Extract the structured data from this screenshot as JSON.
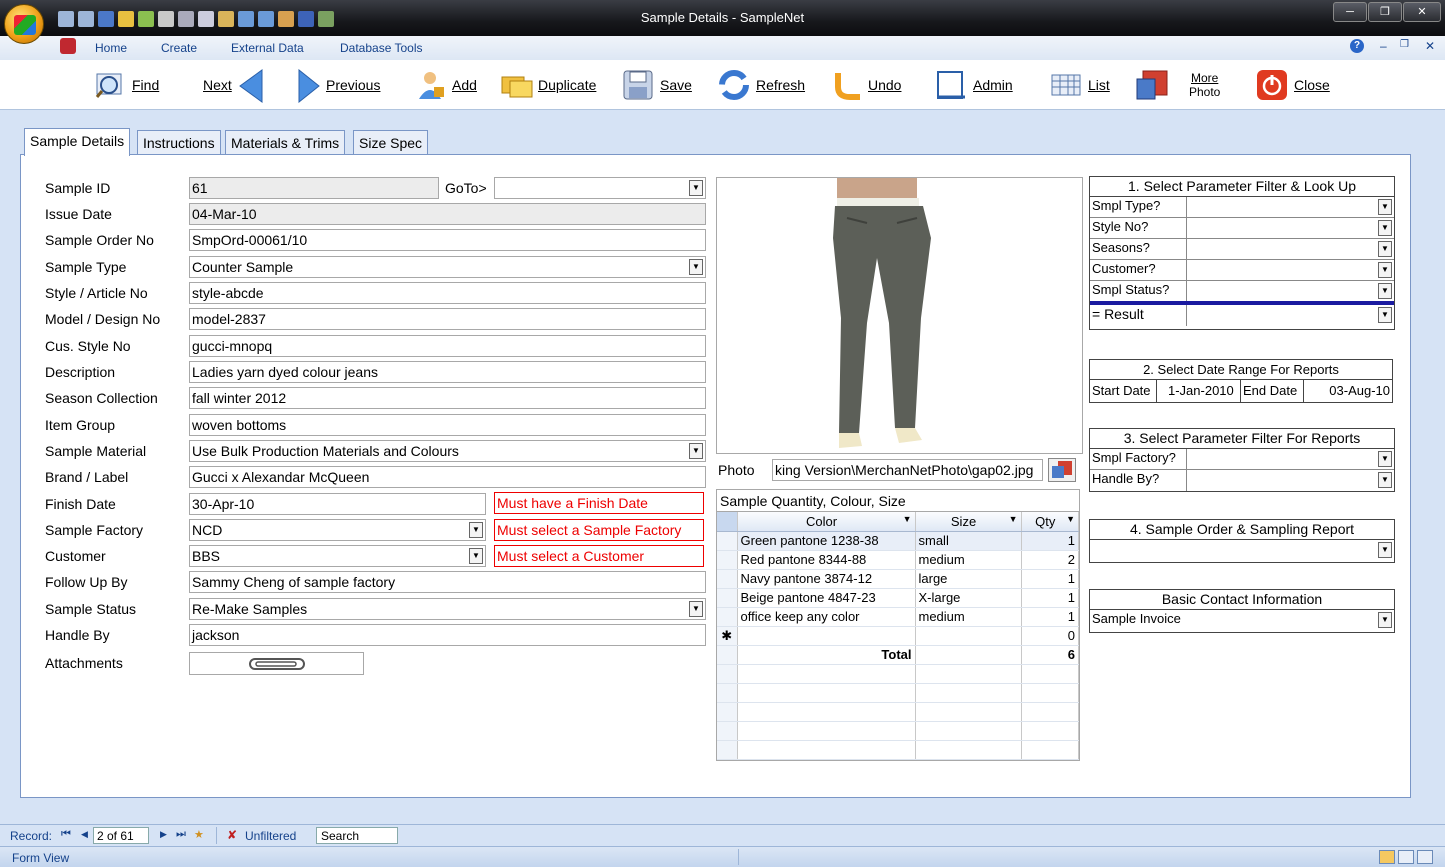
{
  "window": {
    "title": "Sample Details - SampleNet"
  },
  "ribbon": {
    "tabs": [
      "Home",
      "Create",
      "External Data",
      "Database Tools"
    ]
  },
  "toolbar": {
    "find": "Find",
    "next": "Next",
    "previous": "Previous",
    "add": "Add",
    "duplicate": "Duplicate",
    "save": "Save",
    "refresh": "Refresh",
    "undo": "Undo",
    "admin": "Admin",
    "list": "List",
    "more_photo_line1": "More",
    "more_photo_line2": "Photo",
    "close": "Close"
  },
  "form_tabs": [
    "Sample Details",
    "Instructions",
    "Materials & Trims",
    "Size Spec"
  ],
  "fields": {
    "sample_id": {
      "label": "Sample ID",
      "value": "61"
    },
    "goto_label": "GoTo>",
    "issue_date": {
      "label": "Issue Date",
      "value": "04-Mar-10"
    },
    "sample_order_no": {
      "label": "Sample Order No",
      "value": "SmpOrd-00061/10"
    },
    "sample_type": {
      "label": "Sample Type",
      "value": "Counter Sample"
    },
    "style_article_no": {
      "label": "Style / Article No",
      "value": "style-abcde"
    },
    "model_design_no": {
      "label": "Model / Design No",
      "value": "model-2837"
    },
    "cus_style_no": {
      "label": "Cus. Style No",
      "value": "gucci-mnopq"
    },
    "description": {
      "label": "Description",
      "value": "Ladies yarn dyed colour jeans"
    },
    "season_collection": {
      "label": "Season Collection",
      "value": "fall winter 2012"
    },
    "item_group": {
      "label": "Item Group",
      "value": "woven bottoms"
    },
    "sample_material": {
      "label": "Sample Material",
      "value": "Use Bulk Production Materials and Colours"
    },
    "brand_label": {
      "label": "Brand / Label",
      "value": "Gucci x Alexandar McQueen"
    },
    "finish_date": {
      "label": "Finish Date",
      "value": "30-Apr-10",
      "error": "Must have a Finish Date"
    },
    "sample_factory": {
      "label": "Sample Factory",
      "value": "NCD",
      "error": "Must select a Sample Factory"
    },
    "customer": {
      "label": "Customer",
      "value": "BBS",
      "error": "Must select a Customer"
    },
    "follow_up_by": {
      "label": "Follow Up By",
      "value": "Sammy Cheng of sample factory"
    },
    "sample_status": {
      "label": "Sample Status",
      "value": "Re-Make Samples"
    },
    "handle_by": {
      "label": "Handle By",
      "value": "jackson"
    },
    "attachments": {
      "label": "Attachments"
    }
  },
  "photo": {
    "label": "Photo",
    "path": "king Version\\MerchanNetPhoto\\gap02.jpg"
  },
  "quantity_grid": {
    "title": "Sample Quantity, Colour, Size",
    "columns": [
      "Color",
      "Size",
      "Qty"
    ],
    "rows": [
      {
        "color": "Green pantone 1238-38",
        "size": "small",
        "qty": "1"
      },
      {
        "color": "Red pantone 8344-88",
        "size": "medium",
        "qty": "2"
      },
      {
        "color": "Navy pantone 3874-12",
        "size": "large",
        "qty": "1"
      },
      {
        "color": "Beige pantone 4847-23",
        "size": "X-large",
        "qty": "1"
      },
      {
        "color": "office keep any color",
        "size": "medium",
        "qty": "1"
      }
    ],
    "new_row_qty": "0",
    "total_label": "Total",
    "total_qty": "6"
  },
  "filters": {
    "lookup": {
      "title": "1. Select Parameter Filter & Look Up",
      "rows": [
        "Smpl Type?",
        "Style No?",
        "Seasons?",
        "Customer?",
        "Smpl Status?"
      ],
      "result": "= Result"
    },
    "date_range": {
      "title": "2. Select Date Range For  Reports",
      "start_label": "Start Date",
      "start_value": "1-Jan-2010",
      "end_label": "End Date",
      "end_value": "03-Aug-10"
    },
    "reports": {
      "title": "3. Select Parameter Filter For Reports",
      "rows": [
        "Smpl Factory?",
        "Handle By?"
      ]
    },
    "sampling_report": {
      "title": "4. Sample Order & Sampling Report"
    },
    "contact": {
      "title": "Basic Contact Information",
      "value": "Sample Invoice"
    }
  },
  "navigation": {
    "record_label": "Record:",
    "record_value": "2 of 61",
    "filter": "Unfiltered",
    "search": "Search"
  },
  "status": {
    "view": "Form View"
  }
}
